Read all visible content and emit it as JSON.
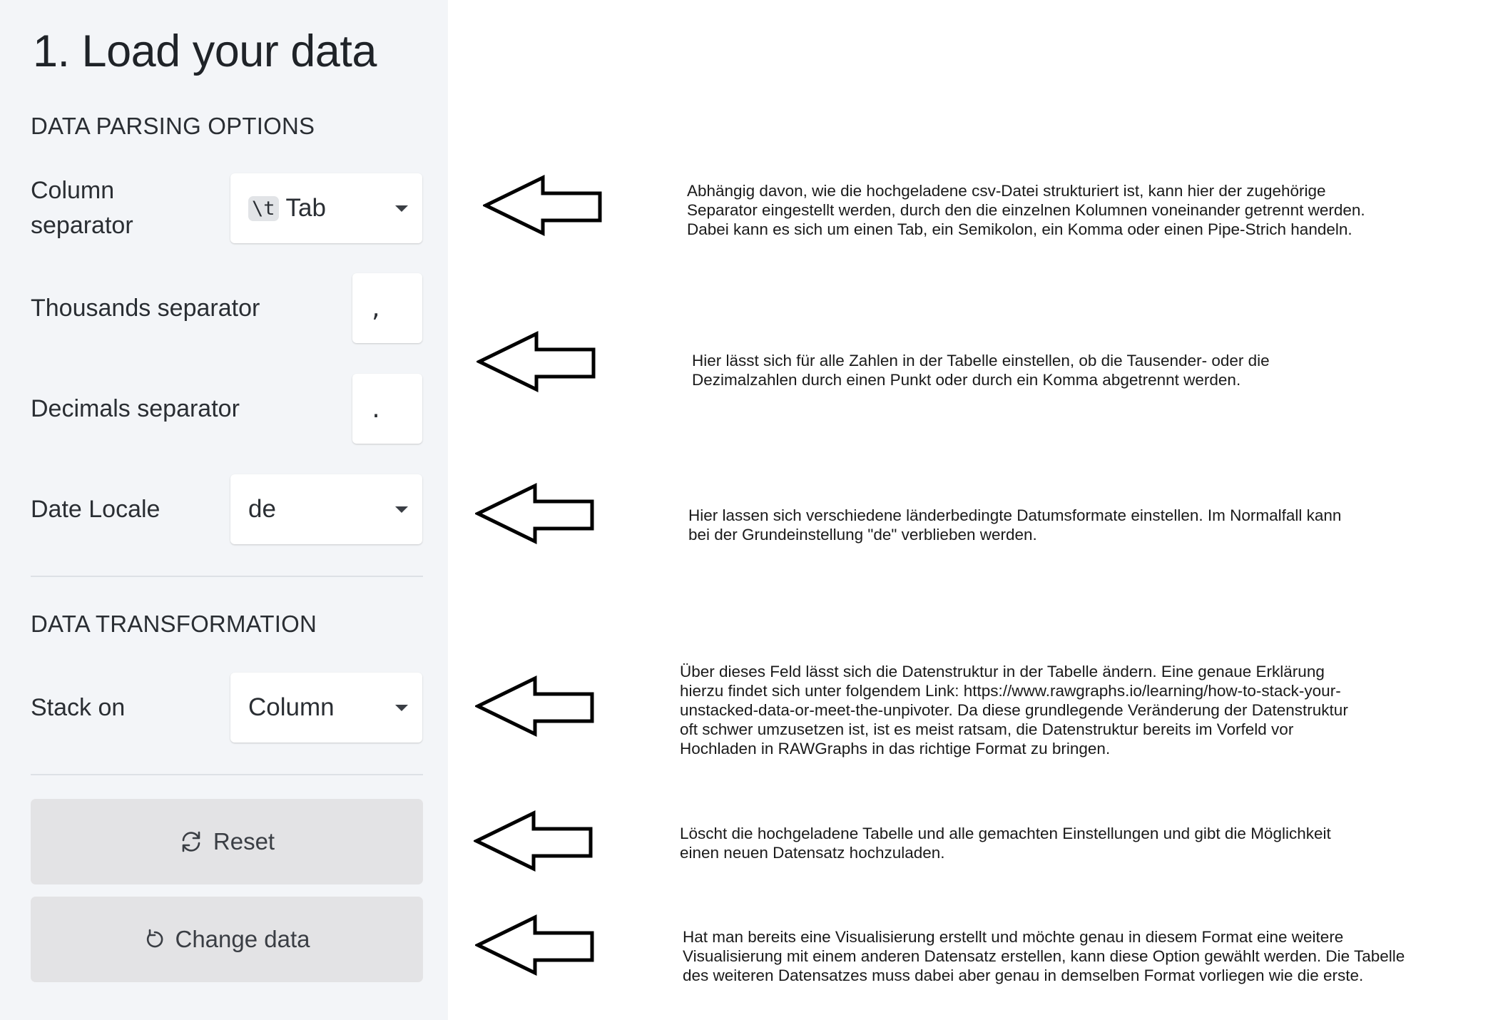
{
  "sidebar": {
    "title": "1. Load your data",
    "parsing_section_title": "DATA PARSING OPTIONS",
    "column_separator": {
      "label": "Column\nseparator",
      "badge": "\\t",
      "value": "Tab"
    },
    "thousands_separator": {
      "label": "Thousands separator",
      "value": ","
    },
    "decimals_separator": {
      "label": "Decimals separator",
      "value": "."
    },
    "date_locale": {
      "label": "Date Locale",
      "value": "de"
    },
    "transformation_section_title": "DATA TRANSFORMATION",
    "stack_on": {
      "label": "Stack on",
      "value": "Column"
    },
    "reset_button": {
      "label": "Reset",
      "icon": "refresh-icon"
    },
    "change_data_button": {
      "label": "Change data",
      "icon": "undo-icon"
    }
  },
  "annotations": [
    {
      "text": "Abhängig davon, wie die hochgeladene csv-Datei strukturiert ist, kann hier der zugehörige\nSeparator eingestellt werden, durch den die einzelnen Kolumnen voneinander getrennt werden.\nDabei kann es sich um einen Tab, ein Semikolon, ein Komma oder einen Pipe-Strich handeln."
    },
    {
      "text": "Hier lässt sich für alle Zahlen in der Tabelle einstellen, ob die Tausender- oder die\nDezimalzahlen durch einen Punkt oder durch ein Komma abgetrennt werden."
    },
    {
      "text": "Hier lassen sich verschiedene länderbedingte Datumsformate einstellen. Im Normalfall kann\nbei der Grundeinstellung \"de\" verblieben werden."
    },
    {
      "text": "Über dieses Feld lässt sich die Datenstruktur in der Tabelle ändern. Eine genaue Erklärung\nhierzu findet sich unter folgendem Link: https://www.rawgraphs.io/learning/how-to-stack-your-\nunstacked-data-or-meet-the-unpivoter. Da diese grundlegende Veränderung der Datenstruktur\noft schwer umzusetzen ist, ist es meist ratsam, die Datenstruktur bereits im Vorfeld vor\nHochladen in RAWGraphs in das richtige Format zu bringen."
    },
    {
      "text": "Löscht die hochgeladene Tabelle und alle gemachten Einstellungen und gibt die Möglichkeit\neinen neuen Datensatz hochzuladen."
    },
    {
      "text": "Hat man bereits eine Visualisierung erstellt und möchte genau in diesem Format eine weitere\nVisualisierung mit einem anderen Datensatz erstellen, kann diese Option gewählt werden. Die Tabelle\ndes weiteren Datensatzes muss dabei aber genau in demselben Format vorliegen wie die erste."
    }
  ],
  "colors": {
    "sidebar_bg": "#f3f5f8",
    "button_bg": "#e3e3e5",
    "text": "#2a2e33"
  }
}
